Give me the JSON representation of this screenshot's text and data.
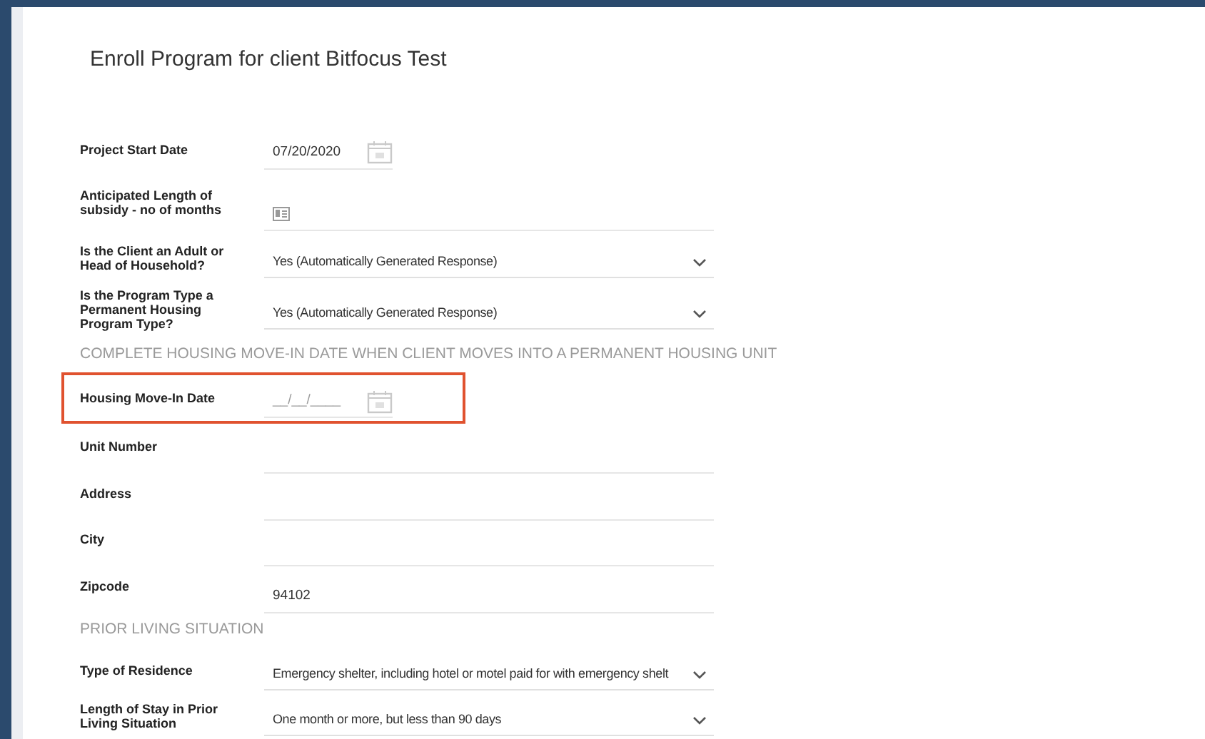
{
  "page": {
    "title": "Enroll Program for client Bitfocus Test"
  },
  "fields": [
    {
      "kind": "date",
      "label": "Project Start Date",
      "value": "07/20/2020",
      "highlighted": false
    },
    {
      "kind": "text_icon",
      "label": "Anticipated Length of subsidy - no of months",
      "highlighted": false
    },
    {
      "kind": "select",
      "label": "Is the Client an Adult or Head of Household?",
      "value": "Yes (Automatically Generated Response)",
      "highlighted": false
    },
    {
      "kind": "select",
      "label": "Is the Program Type a Permanent Housing Program Type?",
      "value": "Yes (Automatically Generated Response)",
      "highlighted": false
    },
    {
      "kind": "heading",
      "label": "COMPLETE HOUSING MOVE-IN DATE WHEN CLIENT MOVES INTO A PERMANENT HOUSING UNIT"
    },
    {
      "kind": "date",
      "label": "Housing Move-In Date",
      "placeholder": "__/__/____",
      "highlighted": true
    },
    {
      "kind": "text",
      "label": "Unit Number",
      "highlighted": false
    },
    {
      "kind": "text",
      "label": "Address",
      "highlighted": false
    },
    {
      "kind": "text",
      "label": "City",
      "highlighted": false
    },
    {
      "kind": "text",
      "label": "Zipcode",
      "value": "94102",
      "highlighted": false
    },
    {
      "kind": "heading",
      "label": "PRIOR LIVING SITUATION"
    },
    {
      "kind": "select",
      "label": "Type of Residence",
      "value": "Emergency shelter, including hotel or motel paid for with emergency shelt",
      "highlighted": false
    },
    {
      "kind": "select",
      "label": "Length of Stay in Prior Living Situation",
      "value": "One month or more, but less than 90 days",
      "highlighted": false
    }
  ]
}
